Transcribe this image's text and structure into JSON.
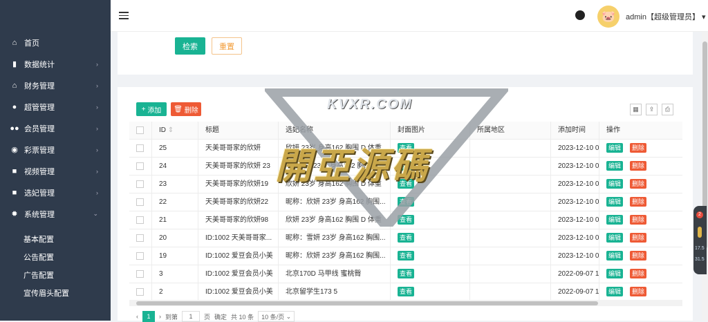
{
  "sidebar": {
    "items": [
      {
        "label": "首页",
        "icon": "home-icon",
        "has_children": false
      },
      {
        "label": "数据统计",
        "icon": "bar-chart-icon",
        "has_children": true
      },
      {
        "label": "财务管理",
        "icon": "bank-icon",
        "has_children": true
      },
      {
        "label": "超管管理",
        "icon": "user-icon",
        "has_children": true
      },
      {
        "label": "会员管理",
        "icon": "users-icon",
        "has_children": true
      },
      {
        "label": "彩票管理",
        "icon": "gamepad-icon",
        "has_children": true
      },
      {
        "label": "视频管理",
        "icon": "video-icon",
        "has_children": true
      },
      {
        "label": "选妃管理",
        "icon": "camera-icon",
        "has_children": true
      },
      {
        "label": "系统管理",
        "icon": "gear-icon",
        "has_children": true,
        "expanded": true
      }
    ],
    "sub_items": [
      "基本配置",
      "公告配置",
      "广告配置",
      "宣传眉头配置"
    ]
  },
  "topbar": {
    "user_label": "admin【超级管理员】"
  },
  "search_card": {
    "search_label": "检索",
    "reset_label": "重置"
  },
  "toolbar": {
    "add_label": "添加",
    "delete_label": "删除"
  },
  "table": {
    "headers": [
      "ID",
      "标题",
      "选妃名称",
      "封面图片",
      "所属地区",
      "添加时间",
      "操作"
    ],
    "view_label": "查看",
    "edit_label": "编辑",
    "delete_label": "删除",
    "rows": [
      {
        "id": "25",
        "title": "天美哥哥家的欣妍",
        "name": "欣妍 23岁 身高162 胸围 D 体重",
        "cover": true,
        "region": "",
        "time": "2023-12-10 08"
      },
      {
        "id": "24",
        "title": "天美哥哥家的欣妍 23",
        "name": "（欣妍）23岁 身高162 胸围 D 体重",
        "cover": true,
        "region": "",
        "time": "2023-12-10 08"
      },
      {
        "id": "23",
        "title": "天美哥哥家的欣妍19",
        "name": "欣妍 23岁 身高162 胸围 D 体重",
        "cover": true,
        "region": "",
        "time": "2023-12-10 08"
      },
      {
        "id": "22",
        "title": "天美哥哥家的欣妍22",
        "name": "昵称：欣妍 23岁 身高162 胸围...",
        "cover": true,
        "region": "",
        "time": "2023-12-10 08"
      },
      {
        "id": "21",
        "title": "天美哥哥家的欣妍98",
        "name": "欣妍 23岁 身高162 胸围 D 体重",
        "cover": true,
        "region": "",
        "time": "2023-12-10 08"
      },
      {
        "id": "20",
        "title": "ID:1002 天美哥哥家...",
        "name": "昵称：雪妍 23岁 身高162 胸围...",
        "cover": true,
        "region": "",
        "time": "2023-12-10 08"
      },
      {
        "id": "19",
        "title": "ID:1002 爱豆会员小美",
        "name": "昵称：欣妍 23岁 身高162 胸围...",
        "cover": true,
        "region": "",
        "time": "2023-12-10 07"
      },
      {
        "id": "3",
        "title": "ID:1002 爱豆会员小美",
        "name": "北京170D 马甲线 蜜桃臀",
        "cover": true,
        "region": "",
        "time": "2022-09-07 17"
      },
      {
        "id": "2",
        "title": "ID:1002 爱豆会员小美",
        "name": "北京留学生173 5",
        "cover": true,
        "region": "",
        "time": "2022-09-07 17"
      }
    ]
  },
  "pagination": {
    "current": "1",
    "goto_label": "到第",
    "goto_value": "1",
    "page_label": "页",
    "confirm_label": "确定",
    "total_label": "共 10 条",
    "size_label": "10 条/页"
  },
  "float_panel": {
    "badge": "2",
    "v1": "17.5",
    "v2": "31.5"
  },
  "watermark": {
    "top": "KVXR.COM",
    "main": "開亞源碼"
  },
  "colors": {
    "sidebar_bg": "#2f3b4c",
    "primary": "#19b393",
    "danger": "#ee5a35",
    "warning": "#f29c38"
  }
}
